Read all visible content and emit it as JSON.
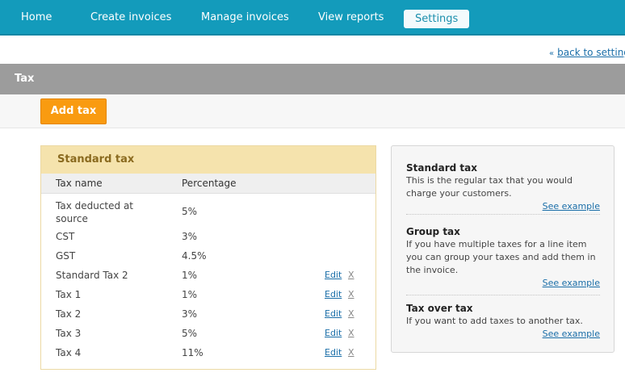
{
  "nav": {
    "items": [
      {
        "label": "Home"
      },
      {
        "label": "Create invoices"
      },
      {
        "label": "Manage invoices"
      },
      {
        "label": "View reports"
      },
      {
        "label": "Settings"
      }
    ],
    "active": "Settings"
  },
  "back": {
    "arrow": "«",
    "label": "back to settings"
  },
  "section": {
    "title": "Tax"
  },
  "toolbar": {
    "add_label": "Add tax"
  },
  "standard_tax": {
    "heading": "Standard tax",
    "columns": {
      "name": "Tax name",
      "percentage": "Percentage"
    },
    "rows": [
      {
        "name": "Tax deducted at source",
        "pct": "5%",
        "edit": "",
        "del": ""
      },
      {
        "name": "CST",
        "pct": "3%",
        "edit": "",
        "del": ""
      },
      {
        "name": "GST",
        "pct": "4.5%",
        "edit": "",
        "del": ""
      },
      {
        "name": "Standard Tax 2",
        "pct": "1%",
        "edit": "Edit",
        "del": "X"
      },
      {
        "name": "Tax 1",
        "pct": "1%",
        "edit": "Edit",
        "del": "X"
      },
      {
        "name": "Tax 2",
        "pct": "3%",
        "edit": "Edit",
        "del": "X"
      },
      {
        "name": "Tax 3",
        "pct": "5%",
        "edit": "Edit",
        "del": "X"
      },
      {
        "name": "Tax 4",
        "pct": "11%",
        "edit": "Edit",
        "del": "X"
      }
    ]
  },
  "info": {
    "sections": [
      {
        "title": "Standard tax",
        "text": "This is the regular tax that you would charge your customers.",
        "link": "See example"
      },
      {
        "title": "Group tax",
        "text": "If you have multiple taxes for a line item you can group your taxes and add them in the invoice.",
        "link": "See example"
      },
      {
        "title": "Tax over tax",
        "text": "If you want to add taxes to another tax.",
        "link": "See example"
      }
    ]
  },
  "colors": {
    "nav_bg": "#139bbb",
    "accent": "#f99b10",
    "section_bar": "#9c9c9c",
    "card_head": "#f5e3ad",
    "link": "#1a6ea8"
  }
}
